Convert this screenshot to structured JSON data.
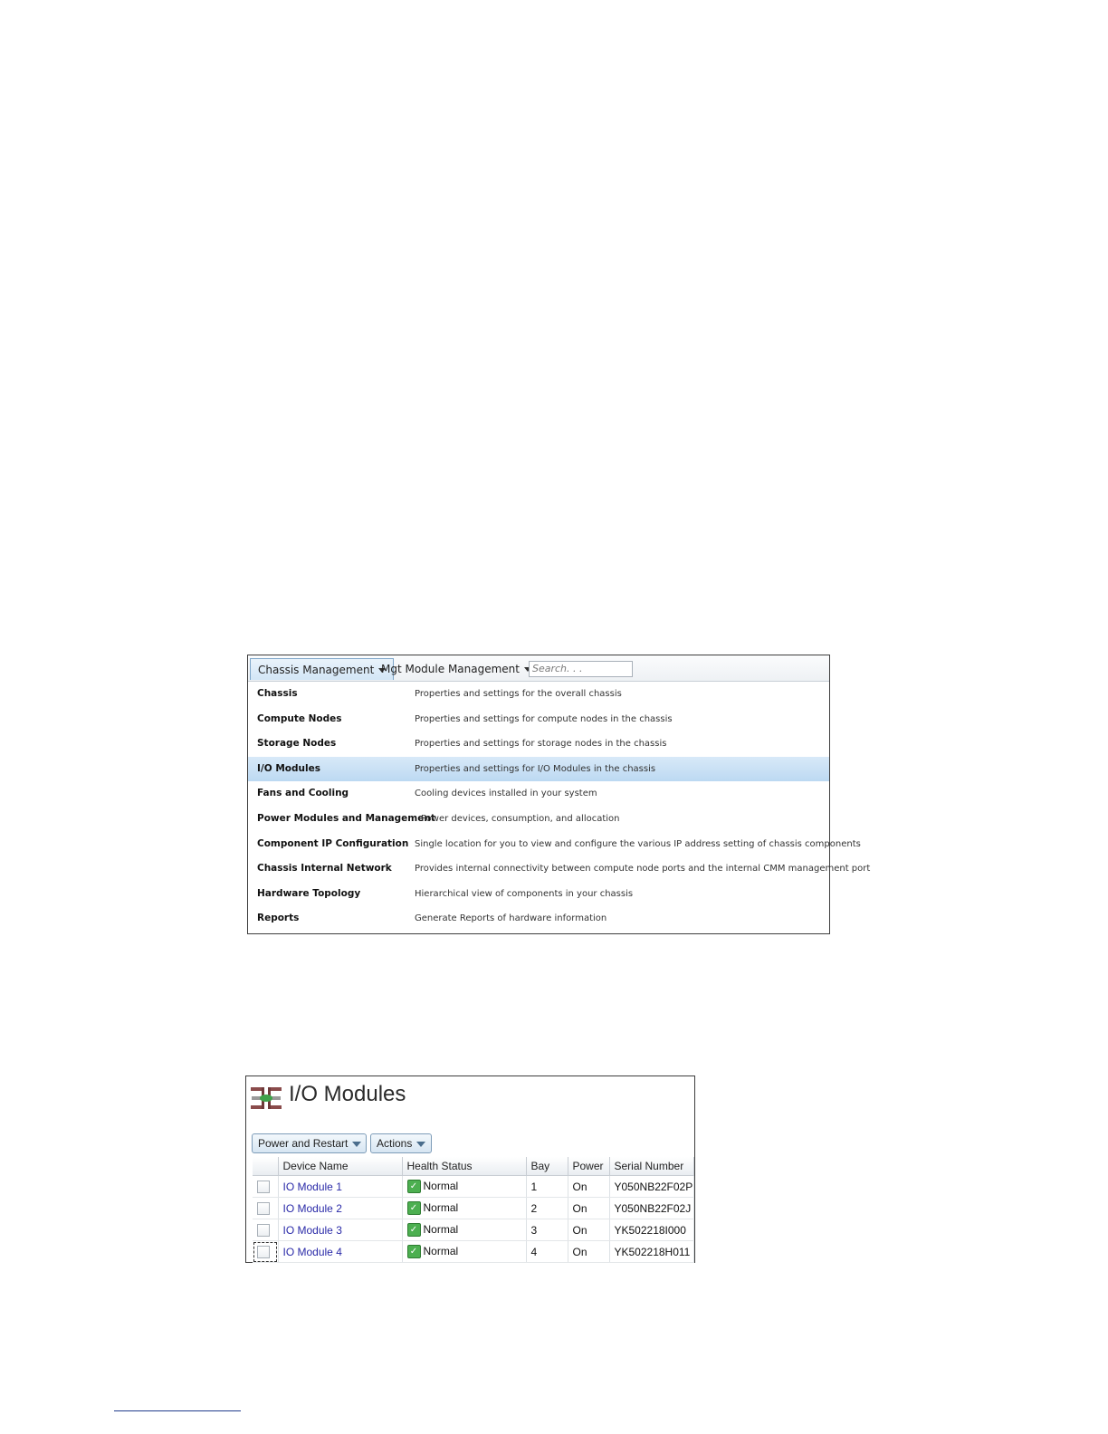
{
  "menu": {
    "tabs": [
      {
        "label": "Chassis Management"
      },
      {
        "label": "Mgt Module Management"
      }
    ],
    "search_placeholder": "Search. . .",
    "items": [
      {
        "name": "Chassis",
        "description": "Properties and settings for the overall chassis"
      },
      {
        "name": "Compute Nodes",
        "description": "Properties and settings for compute nodes in the chassis"
      },
      {
        "name": "Storage Nodes",
        "description": "Properties and settings for storage nodes in the chassis"
      },
      {
        "name": "I/O Modules",
        "description": "Properties and settings for I/O Modules in the chassis",
        "selected": true
      },
      {
        "name": "Fans and Cooling",
        "description": "Cooling devices installed in your system"
      },
      {
        "name": "Power Modules and Management",
        "description": "Power devices, consumption, and allocation"
      },
      {
        "name": "Component IP Configuration",
        "description": "Single location for you to view and configure the various IP address setting of chassis components"
      },
      {
        "name": "Chassis Internal Network",
        "description": "Provides internal connectivity between compute node ports and the internal CMM management port"
      },
      {
        "name": "Hardware Topology",
        "description": "Hierarchical view of components in your chassis"
      },
      {
        "name": "Reports",
        "description": "Generate Reports of hardware information"
      }
    ]
  },
  "io_page": {
    "title": "I/O Modules",
    "icon": "io-module-icon",
    "toolbar": {
      "power_label": "Power and Restart",
      "actions_label": "Actions"
    },
    "columns": [
      "Device Name",
      "Health Status",
      "Bay",
      "Power",
      "Serial Number"
    ],
    "rows": [
      {
        "device": "IO Module 1",
        "health": "Normal",
        "bay": "1",
        "power": "On",
        "serial": "Y050NB22F02P"
      },
      {
        "device": "IO Module 2",
        "health": "Normal",
        "bay": "2",
        "power": "On",
        "serial": "Y050NB22F02J"
      },
      {
        "device": "IO Module 3",
        "health": "Normal",
        "bay": "3",
        "power": "On",
        "serial": "YK502218I000"
      },
      {
        "device": "IO Module 4",
        "health": "Normal",
        "bay": "4",
        "power": "On",
        "serial": "YK502218H011"
      }
    ]
  },
  "colors": {
    "selected_row": "#bcd9f2",
    "link": "#2a2aa8",
    "status_ok": "#4caf50"
  }
}
